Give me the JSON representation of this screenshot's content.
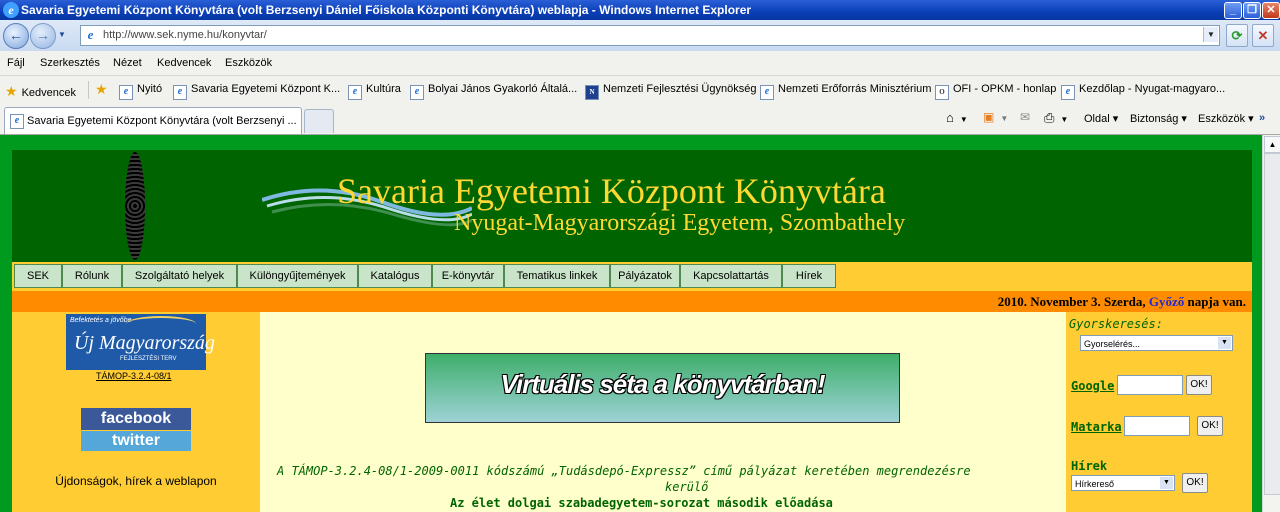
{
  "window": {
    "title": "Savaria Egyetemi Központ Könyvtára (volt Berzsenyi Dániel Főiskola Központi Könyvtára) weblapja - Windows Internet Explorer"
  },
  "address": {
    "url": "http://www.sek.nyme.hu/konyvtar/"
  },
  "menu": [
    "Fájl",
    "Szerkesztés",
    "Nézet",
    "Kedvencek",
    "Eszközök"
  ],
  "favorites": {
    "label": "Kedvencek",
    "items": [
      "Nyitó",
      "Savaria Egyetemi Központ K...",
      "Kultúra",
      "Bolyai János Gyakorló Általá...",
      "Nemzeti Fejlesztési Ügynökség",
      "Nemzeti Erőforrás Minisztérium",
      "OFI - OPKM - honlap",
      "Kezdőlap - Nyugat-magyaro..."
    ]
  },
  "tab": {
    "title": "Savaria Egyetemi Központ Könyvtára (volt Berzsenyi ..."
  },
  "commands": [
    "Oldal",
    "Biztonság",
    "Eszközök"
  ],
  "page": {
    "header_title": "Savaria Egyetemi Központ Könyvtára",
    "header_subtitle": "Nyugat-Magyarországi Egyetem, Szombathely",
    "nav": [
      "SEK",
      "Rólunk",
      "Szolgáltató helyek",
      "Különgyűjtemények",
      "Katalógus",
      "E-könyvtár",
      "Tematikus linkek",
      "Pályázatok",
      "Kapcsolattartás",
      "Hírek"
    ],
    "date": {
      "prefix": "2010. November 3. Szerda, ",
      "name": "Győző",
      "suffix": " napja van."
    },
    "left": {
      "ujm_small": "Befektetés a jövőbe",
      "ujm_main": "Új Magyarország",
      "ujm_sub": "FEJLESZTÉSI TERV",
      "tamop_link": "TÁMOP-3.2.4-08/1",
      "facebook": "facebook",
      "twitter": "twitter",
      "news": "Újdonságok, hírek a weblapon"
    },
    "main": {
      "banner": "Virtuális séta a könyvtárban!",
      "line1": "A TÁMOP-3.2.4-08/1-2009-0011 kódszámú „Tudásdepó-Expressz” című pályázat keretében megrendezésre",
      "line2": "kerülő",
      "line3": "Az élet dolgai szabadegyetem-sorozat második előadása"
    },
    "right": {
      "quick_label": "Gyorskeresés:",
      "quick_select": "Gyorselérés...",
      "google": "Google",
      "matarka": "Matarka",
      "hirek": "Hírek",
      "hir_select": "Hírkereső",
      "ok": "OK!"
    }
  }
}
